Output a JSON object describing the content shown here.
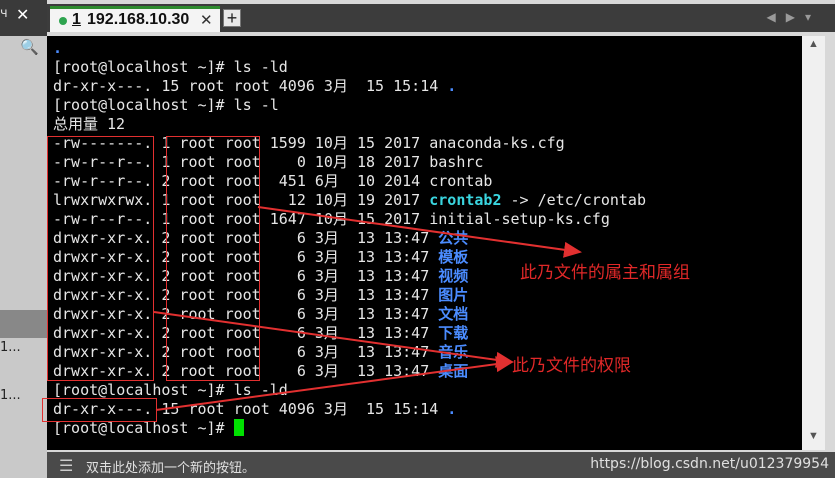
{
  "left_pane": {
    "char1": "ч",
    "close": "✕",
    "row1": "1...",
    "row2": "1..."
  },
  "tab": {
    "number": "1",
    "title": "192.168.10.30",
    "close": "✕",
    "add": "+"
  },
  "nav_icons": [
    "prev-icon",
    "next-icon",
    "menu-icon"
  ],
  "terminal": {
    "lines": [
      {
        "text": ".",
        "color": "blue"
      },
      {
        "text": "[root@localhost ~]# ls -ld"
      },
      {
        "text": "dr-xr-x---. 15 root root 4096 3月  15 15:14 ",
        "suffix": ".",
        "suffix_color": "blue"
      },
      {
        "text": "[root@localhost ~]# ls -l"
      },
      {
        "text": "总用量 12"
      },
      {
        "text": "-rw-------. 1 root root 1599 10月 15 2017 anaconda-ks.cfg"
      },
      {
        "text": "-rw-r--r--. 1 root root    0 10月 18 2017 bashrc"
      },
      {
        "text": "-rw-r--r--. 2 root root  451 6月  10 2014 crontab"
      },
      {
        "text": "lrwxrwxrwx. 1 root root   12 10月 19 2017 ",
        "suffix": "crontab2",
        "suffix_color": "cyan",
        "tail": " -> /etc/crontab"
      },
      {
        "text": "-rw-r--r--. 1 root root 1647 10月 15 2017 initial-setup-ks.cfg"
      },
      {
        "text": "drwxr-xr-x. 2 root root    6 3月  13 13:47 ",
        "suffix": "公共",
        "suffix_color": "blue"
      },
      {
        "text": "drwxr-xr-x. 2 root root    6 3月  13 13:47 ",
        "suffix": "模板",
        "suffix_color": "blue"
      },
      {
        "text": "drwxr-xr-x. 2 root root    6 3月  13 13:47 ",
        "suffix": "视频",
        "suffix_color": "blue"
      },
      {
        "text": "drwxr-xr-x. 2 root root    6 3月  13 13:47 ",
        "suffix": "图片",
        "suffix_color": "blue"
      },
      {
        "text": "drwxr-xr-x. 2 root root    6 3月  13 13:47 ",
        "suffix": "文档",
        "suffix_color": "blue"
      },
      {
        "text": "drwxr-xr-x. 2 root root    6 3月  13 13:47 ",
        "suffix": "下载",
        "suffix_color": "blue"
      },
      {
        "text": "drwxr-xr-x. 2 root root    6 3月  13 13:47 ",
        "suffix": "音乐",
        "suffix_color": "blue"
      },
      {
        "text": "drwxr-xr-x. 2 root root    6 3月  13 13:47 ",
        "suffix": "桌面",
        "suffix_color": "blue"
      },
      {
        "text": "[root@localhost ~]# ls -ld"
      },
      {
        "text": "dr-xr-x---. 15 root root 4096 3月  15 15:14 ",
        "suffix": ".",
        "suffix_color": "blue"
      },
      {
        "text": "[root@localhost ~]# ",
        "cursor": true
      }
    ]
  },
  "annotations": {
    "owner_group": "此乃文件的属主和属组",
    "permissions": "此乃文件的权限"
  },
  "bottom_bar": {
    "hint": "双击此处添加一个新的按钮。",
    "watermark": "https://blog.csdn.net/u012379954"
  },
  "colors": {
    "terminal_bg": "#000000",
    "dir_blue": "#4b8cff",
    "link_cyan": "#3ad6e0",
    "annotation_red": "#e02828",
    "cursor_green": "#00e000"
  }
}
